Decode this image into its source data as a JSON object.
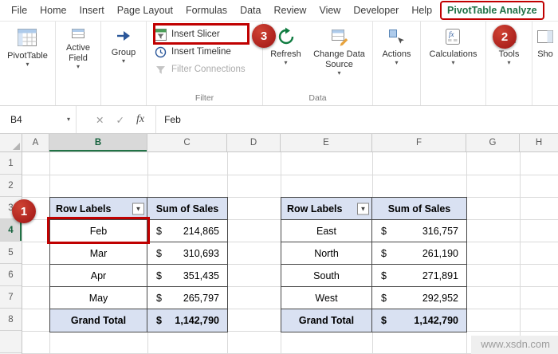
{
  "ribbon": {
    "tabs": [
      "File",
      "Home",
      "Insert",
      "Page Layout",
      "Formulas",
      "Data",
      "Review",
      "View",
      "Developer",
      "Help",
      "PivotTable Analyze"
    ],
    "buttons": {
      "pivottable": "PivotTable",
      "active_field": "Active Field",
      "group": "Group",
      "insert_slicer": "Insert Slicer",
      "insert_timeline": "Insert Timeline",
      "filter_connections": "Filter Connections",
      "refresh": "Refresh",
      "change_data_source": "Change Data Source",
      "actions": "Actions",
      "calculations": "Calculations",
      "tools": "Tools",
      "show": "Sho"
    },
    "group_labels": {
      "filter": "Filter",
      "data": "Data"
    }
  },
  "formula_bar": {
    "cell_ref": "B4",
    "formula": "Feb"
  },
  "grid": {
    "col_headers": [
      "A",
      "B",
      "C",
      "D",
      "E",
      "F",
      "G",
      "H"
    ],
    "row_headers": [
      "1",
      "2",
      "3",
      "4",
      "5",
      "6",
      "7",
      "8"
    ]
  },
  "pivot_left": {
    "header_label": "Row Labels",
    "header_value": "Sum of Sales",
    "rows": [
      {
        "label": "Feb",
        "cur": "$",
        "amount": "214,865"
      },
      {
        "label": "Mar",
        "cur": "$",
        "amount": "310,693"
      },
      {
        "label": "Apr",
        "cur": "$",
        "amount": "351,435"
      },
      {
        "label": "May",
        "cur": "$",
        "amount": "265,797"
      }
    ],
    "total": {
      "label": "Grand Total",
      "cur": "$",
      "amount": "1,142,790"
    }
  },
  "pivot_right": {
    "header_label": "Row Labels",
    "header_value": "Sum of Sales",
    "rows": [
      {
        "label": "East",
        "cur": "$",
        "amount": "316,757"
      },
      {
        "label": "North",
        "cur": "$",
        "amount": "261,190"
      },
      {
        "label": "South",
        "cur": "$",
        "amount": "271,891"
      },
      {
        "label": "West",
        "cur": "$",
        "amount": "292,952"
      }
    ],
    "total": {
      "label": "Grand Total",
      "cur": "$",
      "amount": "1,142,790"
    }
  },
  "annotations": {
    "step1": "1",
    "step2": "2",
    "step3": "3"
  },
  "icons": {
    "caret": "▾",
    "filter_dropdown": "▼",
    "cancel": "✕",
    "enter": "✓",
    "fx": "fx"
  },
  "watermark": "www.xsdn.com",
  "colors": {
    "accent_green": "#217346",
    "annotation_red": "#C00000",
    "pivot_header_fill": "#D9E1F2"
  }
}
